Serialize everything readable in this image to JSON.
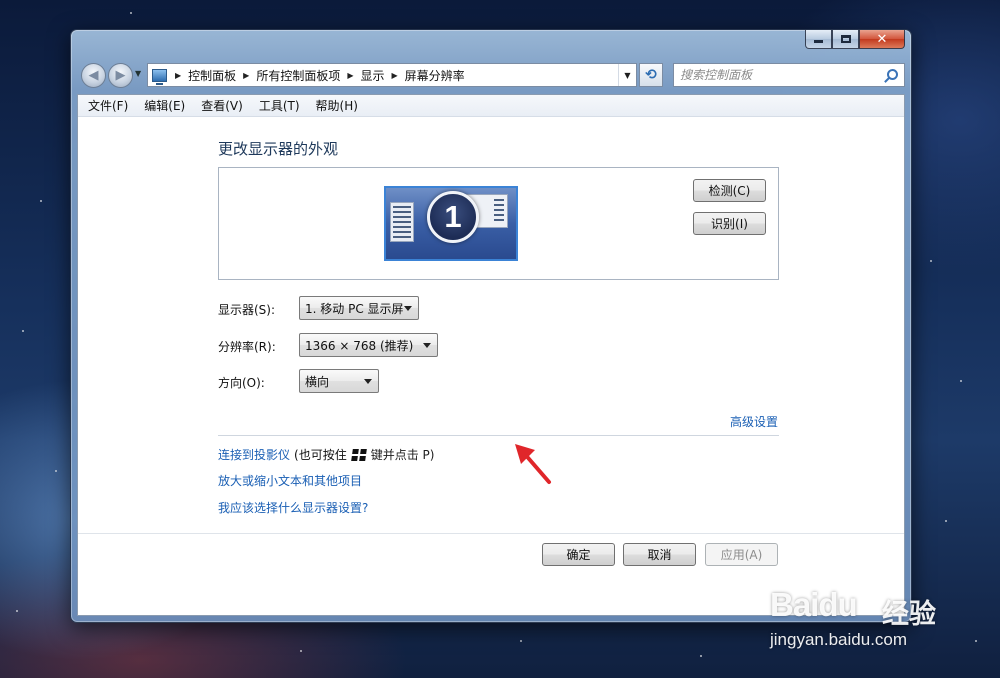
{
  "window": {
    "caption_buttons": [
      "minimize-icon",
      "maximize-icon",
      "close-icon"
    ]
  },
  "navigation": {
    "breadcrumbs": [
      "控制面板",
      "所有控制面板项",
      "显示",
      "屏幕分辨率"
    ],
    "search_placeholder": "搜索控制面板"
  },
  "menubar": {
    "items": [
      "文件(F)",
      "编辑(E)",
      "查看(V)",
      "工具(T)",
      "帮助(H)"
    ]
  },
  "main": {
    "title": "更改显示器的外观",
    "monitor_number": "1",
    "detect_label": "检测(C)",
    "identify_label": "识别(I)",
    "display_label": "显示器(S):",
    "display_value": "1. 移动 PC 显示屏",
    "resolution_label": "分辨率(R):",
    "resolution_value": "1366 × 768 (推荐)",
    "orientation_label": "方向(O):",
    "orientation_value": "横向",
    "advanced_link": "高级设置",
    "projector_link": "连接到投影仪",
    "projector_hint_before": "(也可按住",
    "projector_hint_after": "键并点击 P)",
    "text_size_link": "放大或缩小文本和其他项目",
    "help_link": "我应该选择什么显示器设置?",
    "ok_label": "确定",
    "cancel_label": "取消",
    "apply_label": "应用(A)"
  },
  "annotation": {
    "arrow_color": "#e0262a"
  },
  "watermark": {
    "brand": "Baidu",
    "brand_cn": "经验",
    "url": "jingyan.baidu.com"
  },
  "colors": {
    "link": "#1a5fb4",
    "title": "#1e395b",
    "monitor_border": "#3b83d6"
  }
}
